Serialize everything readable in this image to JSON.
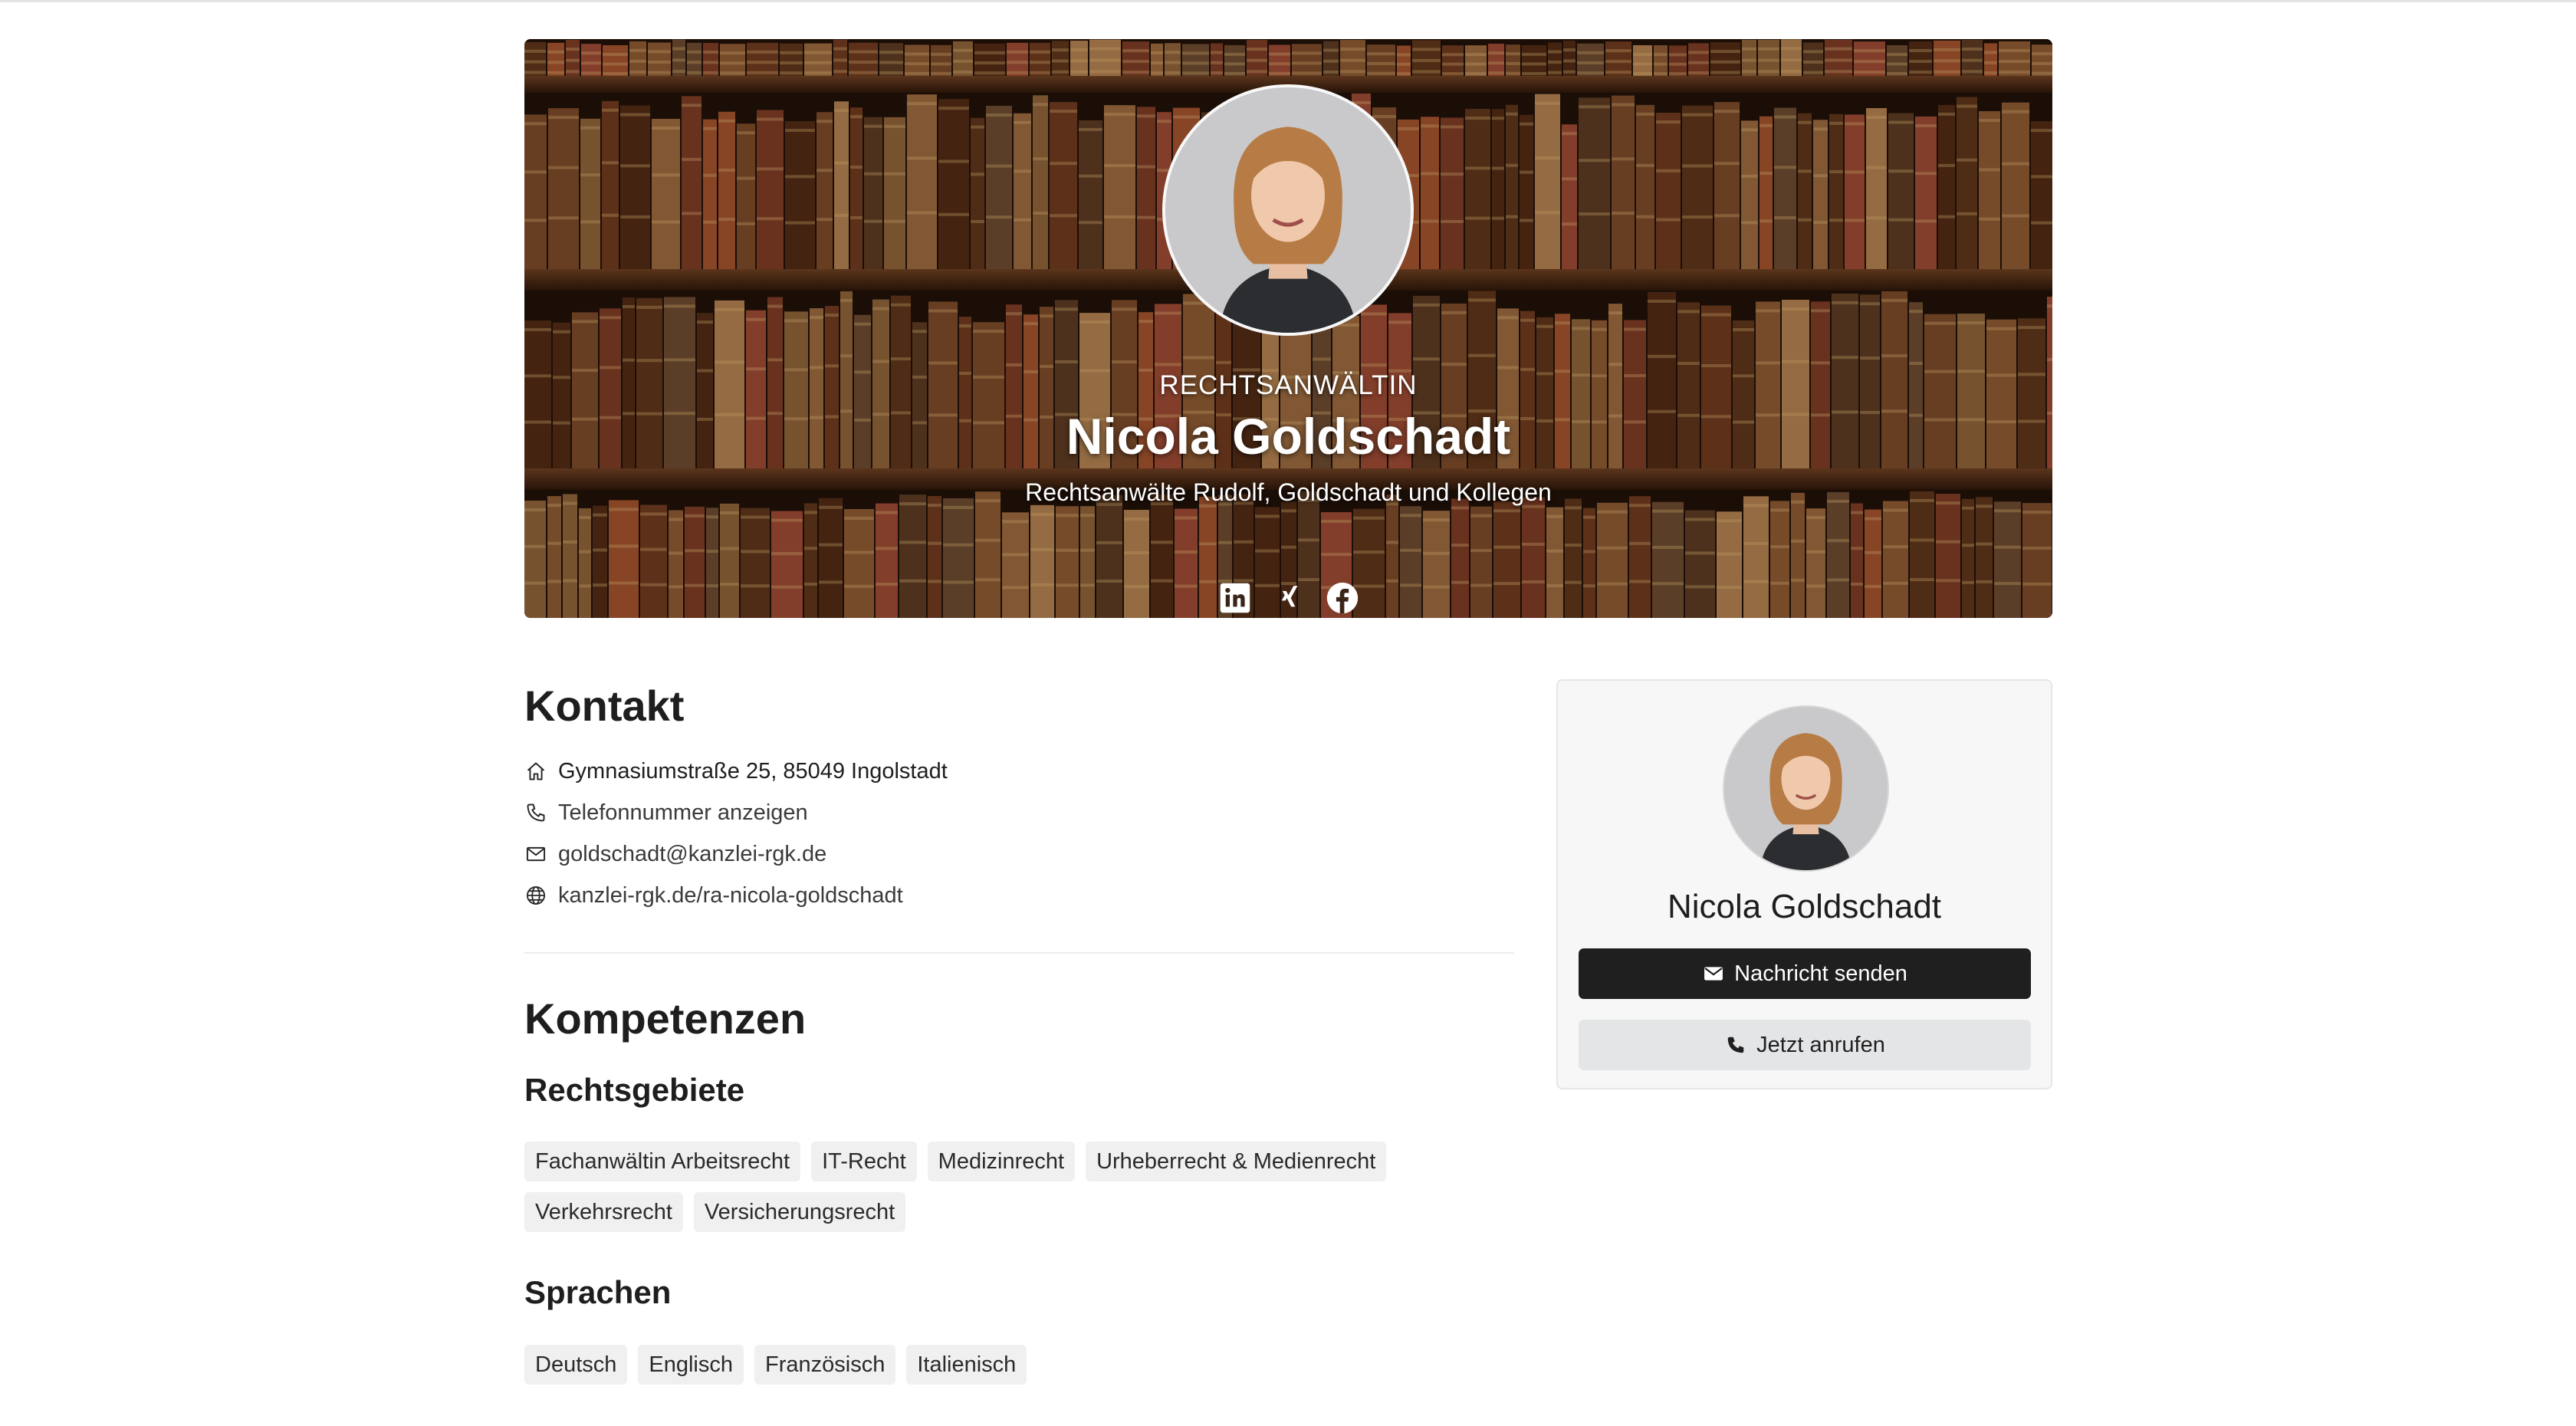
{
  "hero": {
    "role": "RECHTSANWÄLTIN",
    "name": "Nicola Goldschadt",
    "firm": "Rechtsanwälte Rudolf, Goldschadt und Kollegen",
    "socials": [
      {
        "icon": "linkedin-icon"
      },
      {
        "icon": "xing-icon"
      },
      {
        "icon": "facebook-icon"
      }
    ]
  },
  "contact": {
    "heading": "Kontakt",
    "address": "Gymnasiumstraße 25, 85049 Ingolstadt",
    "phone": "Telefonnummer anzeigen",
    "email": "goldschadt@kanzlei-rgk.de",
    "website": "kanzlei-rgk.de/ra-nicola-goldschadt"
  },
  "skills": {
    "heading": "Kompetenzen",
    "areas_heading": "Rechtsgebiete",
    "areas": [
      "Fachanwältin Arbeitsrecht",
      "IT-Recht",
      "Medizinrecht",
      "Urheberrecht & Medienrecht",
      "Verkehrsrecht",
      "Versicherungsrecht"
    ],
    "languages_heading": "Sprachen",
    "languages": [
      "Deutsch",
      "Englisch",
      "Französisch",
      "Italienisch"
    ]
  },
  "card": {
    "name": "Nicola Goldschadt",
    "message_label": "Nachricht senden",
    "call_label": "Jetzt anrufen"
  },
  "colors": {
    "primary_button": "#1f1f1f",
    "secondary_button": "#e4e5e7",
    "tag_bg": "#f0f0f0"
  }
}
